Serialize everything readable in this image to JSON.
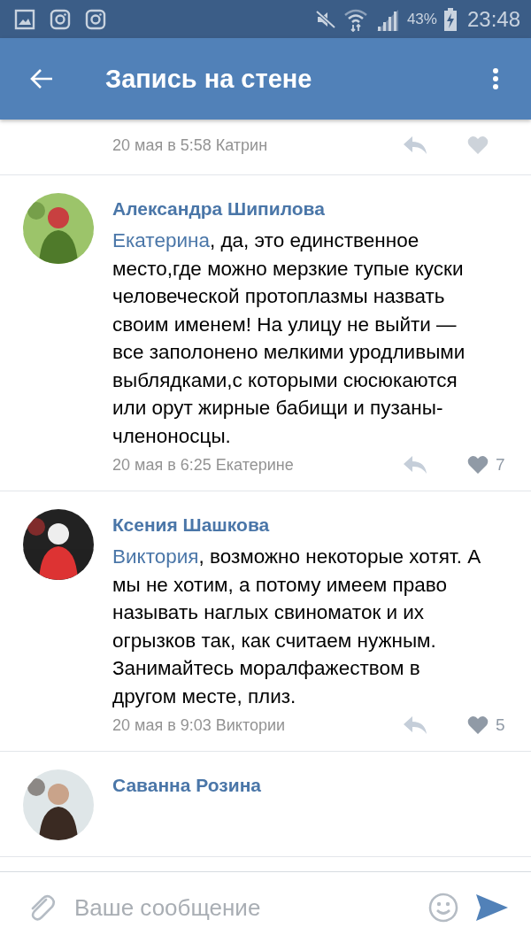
{
  "status_bar": {
    "battery_percent": "43%",
    "time": "23:48"
  },
  "header": {
    "title": "Запись на стене"
  },
  "comments": [
    {
      "date": "20 мая в 5:58",
      "reply_to": "Катрин"
    },
    {
      "author": "Александра Шипилова",
      "mention": "Екатерина",
      "text": ", да, это единственное место,где можно мерзкие тупые куски человеческой протоплазмы назвать своим именем! На улицу не выйти — все заполонено мелкими уродливыми выблядками,с которыми сюсюкаются или орут жирные бабищи и пузаны-членоносцы.",
      "date": "20 мая в 6:25",
      "reply_to": "Екатерине",
      "likes": "7"
    },
    {
      "author": "Ксения Шашкова",
      "mention": "Виктория",
      "text": ", возможно некоторые хотят. А мы не хотим, а потому имеем право называть наглых свиноматок и их огрызков так, как считаем нужным. Занимайтесь моралфажеством в другом месте, плиз.",
      "date": "20 мая в 9:03",
      "reply_to": "Виктории",
      "likes": "5"
    },
    {
      "author": "Саванна Розина"
    }
  ],
  "composer": {
    "placeholder": "Ваше сообщение"
  }
}
